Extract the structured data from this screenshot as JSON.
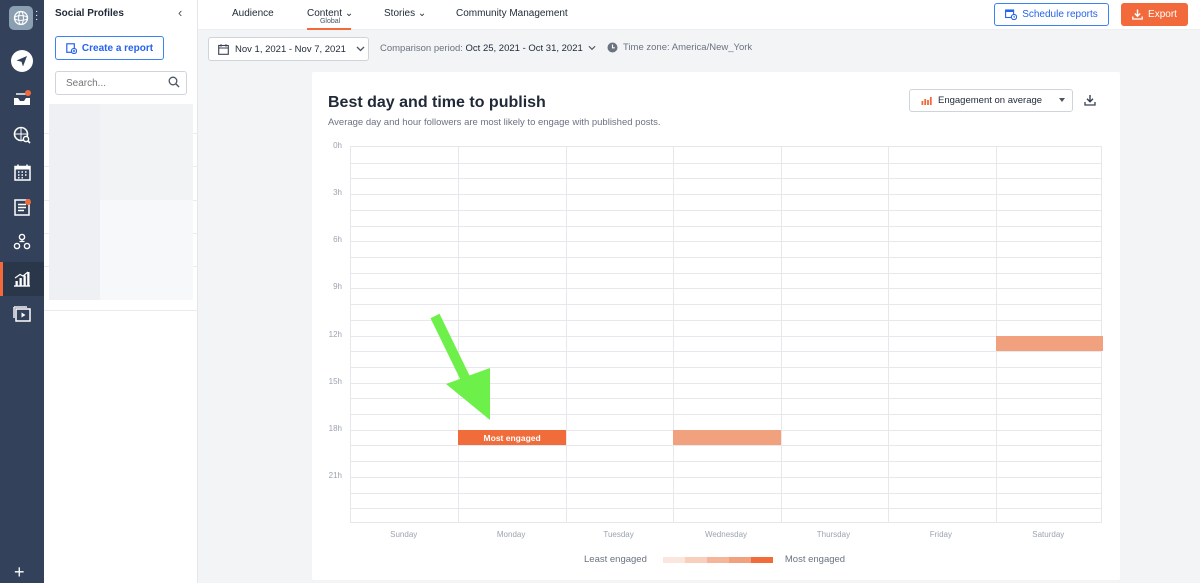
{
  "rail": {
    "icons": [
      "hootsuite-logo",
      "publish-icon",
      "inbox-icon",
      "streams-icon",
      "planner-icon",
      "reviews-icon",
      "teams-icon",
      "analytics-icon",
      "videos-icon"
    ]
  },
  "profiles": {
    "title": "Social Profiles",
    "create_label": "Create a report",
    "search_placeholder": "Search..."
  },
  "nav": {
    "tabs": [
      {
        "label": "Audience"
      },
      {
        "label": "Content",
        "sub": "Global",
        "caret": "⌄"
      },
      {
        "label": "Stories",
        "caret": "⌄"
      },
      {
        "label": "Community Management"
      }
    ],
    "schedule_label": "Schedule reports",
    "export_label": "Export"
  },
  "filters": {
    "date_range": "Nov 1, 2021 - Nov 7, 2021",
    "comparison_label": "Comparison period:",
    "comparison_value": "Oct 25, 2021 - Oct 31, 2021",
    "timezone": "Time zone: America/New_York"
  },
  "card": {
    "title": "Best day and time to publish",
    "subtitle": "Average day and hour followers are most likely to engage with published posts.",
    "metric": "Engagement on average"
  },
  "chart_data": {
    "type": "heatmap",
    "title": "Best day and time to publish",
    "subtitle": "Average day and hour followers are most likely to engage with published posts.",
    "x_categories": [
      "Sunday",
      "Monday",
      "Tuesday",
      "Wednesday",
      "Thursday",
      "Friday",
      "Saturday"
    ],
    "y_tick_labels": [
      "0h",
      "3h",
      "6h",
      "9h",
      "12h",
      "15h",
      "18h",
      "21h"
    ],
    "y_range_hours": [
      0,
      24
    ],
    "highlighted_cells": [
      {
        "day": "Monday",
        "hour": 18,
        "level": 5,
        "label": "Most engaged"
      },
      {
        "day": "Wednesday",
        "hour": 18,
        "level": 4
      },
      {
        "day": "Saturday",
        "hour": 12,
        "level": 4
      }
    ],
    "legend": {
      "low": "Least engaged",
      "high": "Most engaged",
      "levels": 5
    },
    "colors": [
      "#fbe5dc",
      "#f8cfbd",
      "#f5b598",
      "#f2a17e",
      "#f06c3b"
    ]
  }
}
